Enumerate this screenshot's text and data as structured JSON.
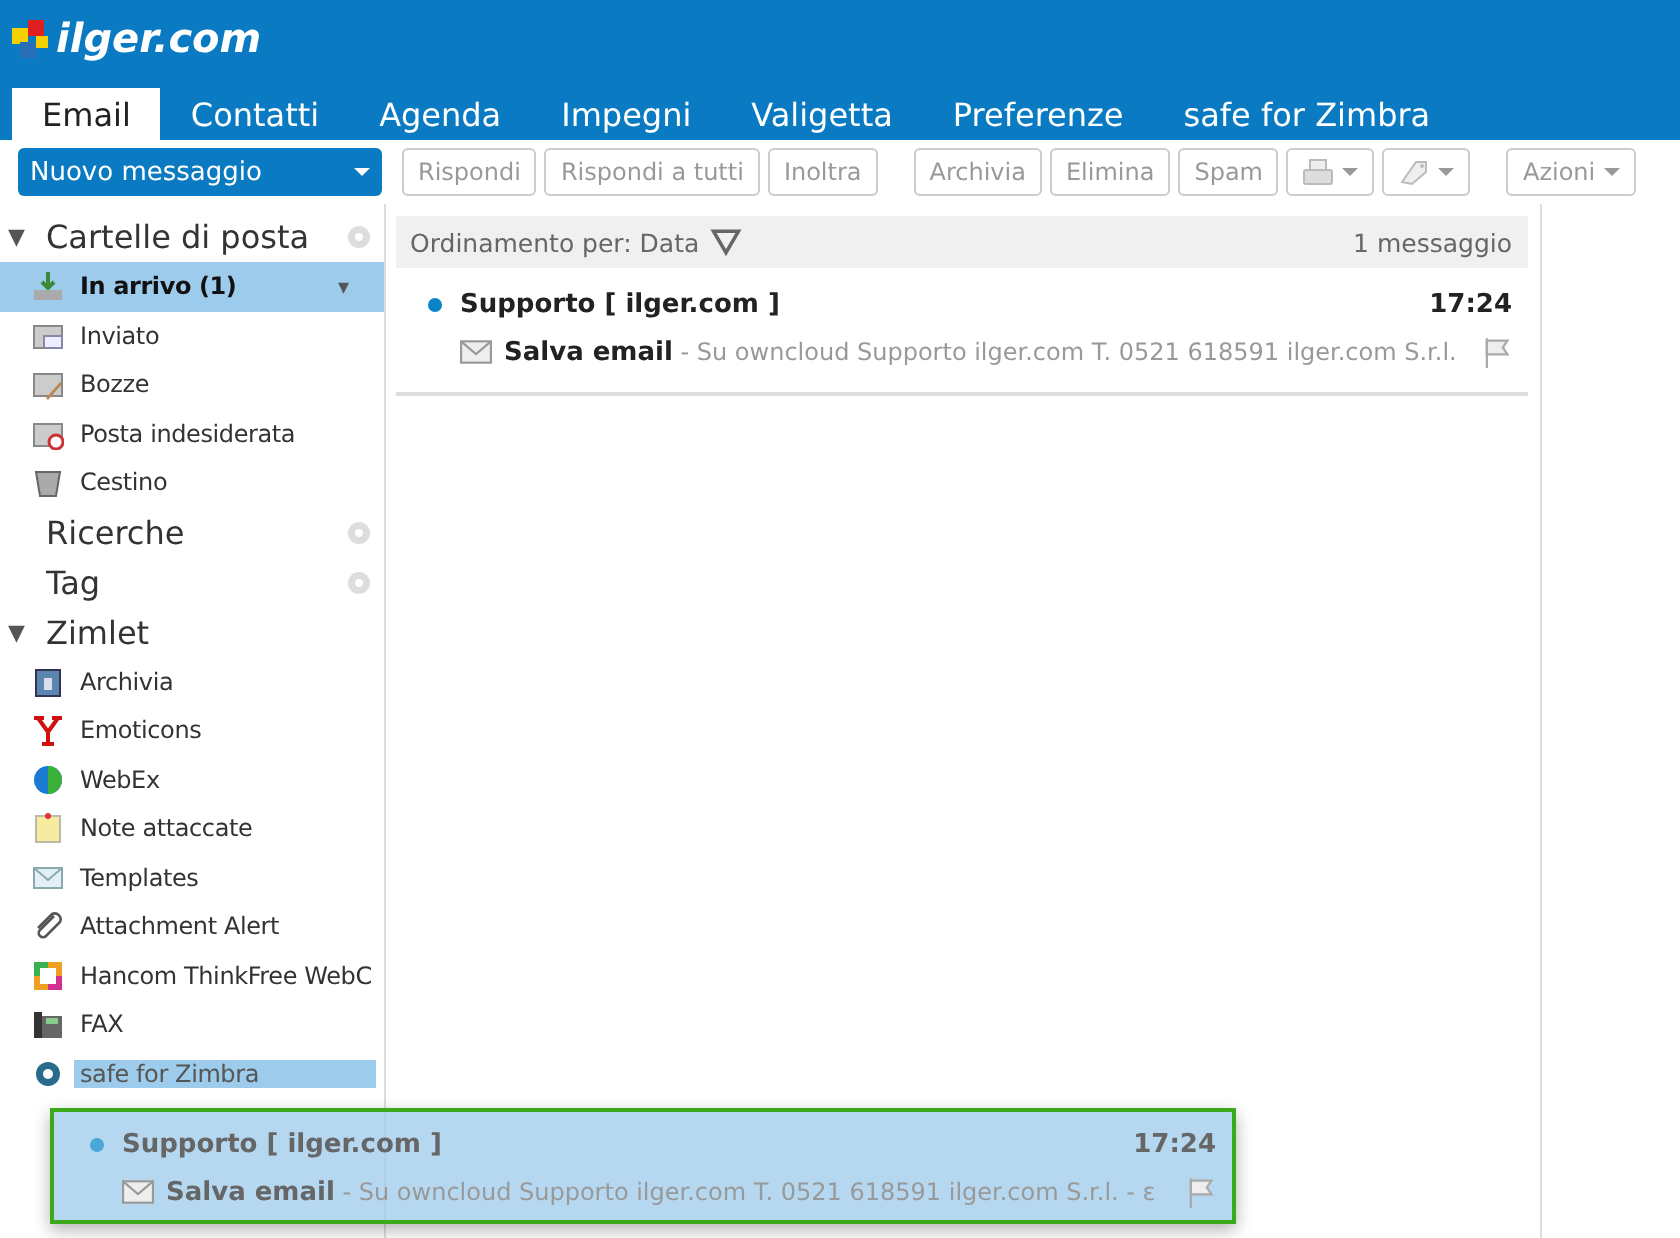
{
  "logo": {
    "text": "ilger.com"
  },
  "tabs": [
    {
      "label": "Email",
      "selected": true
    },
    {
      "label": "Contatti",
      "selected": false
    },
    {
      "label": "Agenda",
      "selected": false
    },
    {
      "label": "Impegni",
      "selected": false
    },
    {
      "label": "Valigetta",
      "selected": false
    },
    {
      "label": "Preferenze",
      "selected": false
    },
    {
      "label": "safe for Zimbra",
      "selected": false
    }
  ],
  "toolbar": {
    "new_button": "Nuovo messaggio",
    "buttons": [
      {
        "kind": "text",
        "label": "Rispondi"
      },
      {
        "kind": "text",
        "label": "Rispondi a tutti"
      },
      {
        "kind": "text",
        "label": "Inoltra"
      },
      {
        "kind": "gap"
      },
      {
        "kind": "text",
        "label": "Archivia"
      },
      {
        "kind": "text",
        "label": "Elimina"
      },
      {
        "kind": "text",
        "label": "Spam"
      },
      {
        "kind": "print"
      },
      {
        "kind": "tag"
      },
      {
        "kind": "gap"
      },
      {
        "kind": "menu",
        "label": "Azioni"
      }
    ]
  },
  "sidebar": {
    "sections": [
      {
        "toggle": "▼",
        "title": "Cartelle di posta",
        "gear": true,
        "items": [
          {
            "label": "In arrivo (1)",
            "menu_arrow": "▾",
            "selected": true
          },
          {
            "label": "Inviato",
            "selected": false
          },
          {
            "label": "Bozze",
            "selected": false
          },
          {
            "label": "Posta indesiderata",
            "selected": false
          },
          {
            "label": "Cestino",
            "selected": false
          }
        ]
      },
      {
        "title": "Ricerche",
        "gear": true
      },
      {
        "title": "Tag",
        "gear": true
      },
      {
        "toggle": "▼",
        "title": "Zimlet",
        "gear": false,
        "items": [
          {
            "label": "Archivia",
            "selected": false
          },
          {
            "label": "Emoticons",
            "selected": false
          },
          {
            "label": "WebEx",
            "selected": false
          },
          {
            "label": "Note attaccate",
            "selected": false
          },
          {
            "label": "Templates",
            "selected": false
          },
          {
            "label": "Attachment Alert",
            "selected": false
          },
          {
            "label": "Hancom ThinkFree WebC",
            "selected": false
          },
          {
            "label": "FAX",
            "selected": false
          },
          {
            "label": "safe for Zimbra",
            "selected": true
          }
        ]
      }
    ]
  },
  "list": {
    "sort_label": "Ordinamento per: Data",
    "count": "1 messaggio",
    "messages": [
      {
        "sender": "Supporto [ ilger.com ]",
        "time": "17:24",
        "unread": true,
        "subject": "Salva email",
        "preview": "- Su owncloud Supporto ilger.com T. 0521 618591 ilger.com S.r.l.",
        "flagged": false
      }
    ]
  },
  "drag_ghost": {
    "sender": "Supporto [ ilger.com ]",
    "time": "17:24",
    "unread": true,
    "subject": "Salva email",
    "preview": "- Su owncloud Supporto ilger.com T. 0521 618591 ilger.com S.r.l. - ε",
    "flagged": false
  }
}
